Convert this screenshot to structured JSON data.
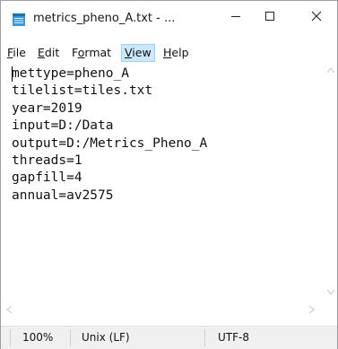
{
  "window": {
    "title": "metrics_pheno_A.txt - ...",
    "icon": "notepad-icon",
    "controls": [
      "minimize-icon",
      "maximize-icon",
      "close-icon"
    ]
  },
  "menu": {
    "items": [
      {
        "label_pre": "",
        "label_ul": "F",
        "label_post": "ile"
      },
      {
        "label_pre": "",
        "label_ul": "E",
        "label_post": "dit"
      },
      {
        "label_pre": "F",
        "label_ul": "o",
        "label_post": "rmat"
      },
      {
        "label_pre": "",
        "label_ul": "V",
        "label_post": "iew"
      },
      {
        "label_pre": "",
        "label_ul": "H",
        "label_post": "elp"
      }
    ],
    "active_index": 3
  },
  "editor": {
    "content": "mettype=pheno_A\ntilelist=tiles.txt\nyear=2019\ninput=D:/Data\noutput=D:/Metrics_Pheno_A\nthreads=1\ngapfill=4\nannual=av2575"
  },
  "status": {
    "zoom": "100%",
    "line_ending": "Unix (LF)",
    "encoding": "UTF-8"
  }
}
